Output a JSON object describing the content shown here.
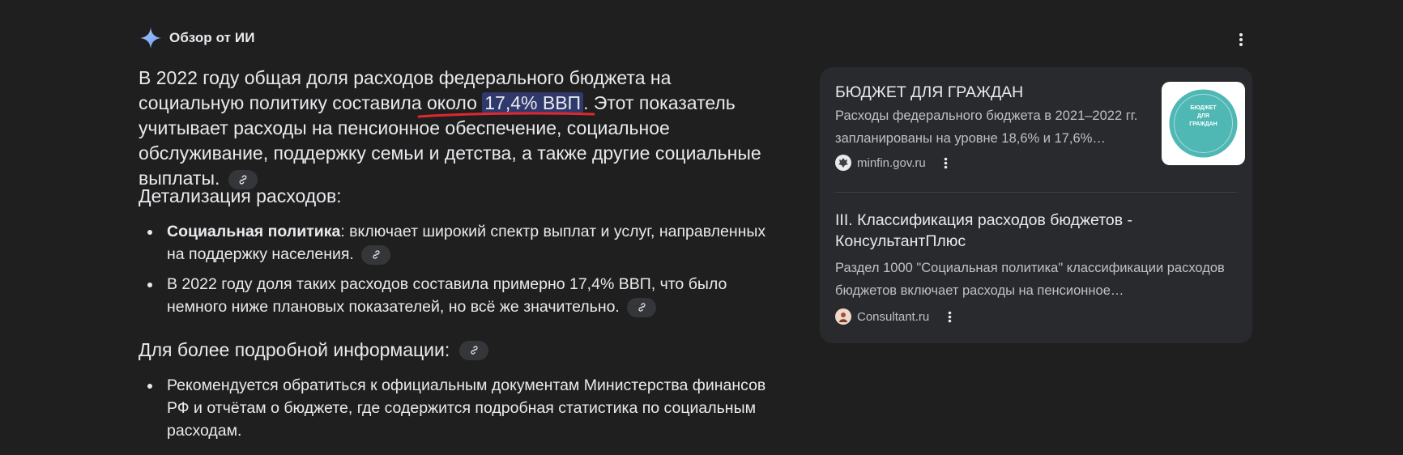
{
  "header": {
    "title": "Обзор от ИИ",
    "icon": "sparkle-icon",
    "menu_icon": "more-vert-icon"
  },
  "main": {
    "lead_part1": "В 2022 году общая доля расходов федерального бюджета на социальную политику составила около ",
    "lead_highlight": "17,4% ВВП",
    "lead_part2": ". Этот показатель учитывает расходы на пенсионное обеспечение, социальное обслуживание, поддержку семьи и детства, а также другие социальные выплаты.",
    "section1_title": "Детализация расходов:",
    "bullets1": [
      {
        "bold": "Социальная политика",
        "text": ": включает широкий спектр выплат и услуг, направленных на поддержку населения."
      },
      {
        "bold": "",
        "text": "В 2022 году доля таких расходов составила примерно 17,4% ВВП, что было немного ниже плановых показателей, но всё же значительно."
      }
    ],
    "section2_title": "Для более подробной информации:",
    "bullets2": [
      {
        "text": "Рекомендуется обратиться к официальным документам Министерства финансов РФ и отчётам о бюджете, где содержится подробная статистика по социальным расходам."
      }
    ]
  },
  "sources": [
    {
      "title": "БЮДЖЕТ ДЛЯ ГРАЖДАН",
      "snippet": "Расходы федерального бюджета в 2021–2022 гг. запланированы на уровне 18,6% и 17,6%…",
      "site": "minfin.gov.ru",
      "thumb_text": "БЮДЖЕТ ДЛЯ ГРАЖДАН"
    },
    {
      "title": "III. Классификация расходов бюджетов - КонсультантПлюс",
      "snippet": "Раздел 1000 \"Социальная политика\" классификации расходов бюджетов включает расходы на пенсионное…",
      "site": "Consultant.ru"
    }
  ],
  "colors": {
    "background": "#1f1f1f",
    "panel": "#282a2e",
    "highlight": "#30396c",
    "underline": "#e0282e",
    "sparkle": "#8ab4f8",
    "thumb_circle": "#4fb8b4"
  }
}
